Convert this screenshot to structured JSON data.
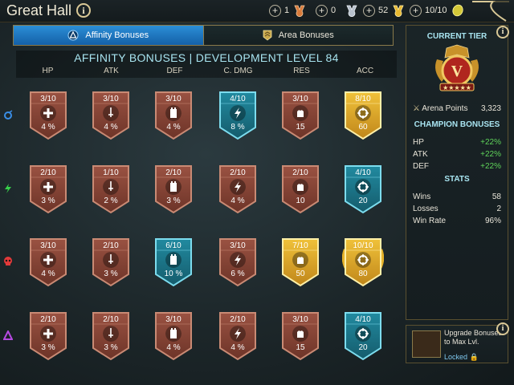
{
  "header": {
    "title": "Great Hall",
    "resources": [
      {
        "value": "1",
        "gem": "bronze-medal-icon",
        "color": "#d97a3a"
      },
      {
        "value": "0",
        "gem": "silver-medal-icon",
        "color": "#b7c0cc"
      },
      {
        "value": "52",
        "gem": "gold-medal-icon",
        "color": "#e8b830"
      },
      {
        "value": "10/10",
        "gem": "arena-token-icon",
        "color": "#d4c838"
      }
    ]
  },
  "tabs": [
    {
      "label": "Affinity Bonuses",
      "active": true
    },
    {
      "label": "Area Bonuses",
      "active": false
    }
  ],
  "section_title": "AFFINITY BONUSES | DEVELOPMENT LEVEL 84",
  "columns": [
    "HP",
    "ATK",
    "DEF",
    "C. DMG",
    "RES",
    "ACC"
  ],
  "rows": [
    {
      "affinity": "magic-affinity-icon",
      "color": "#3a8ee6",
      "cells": [
        {
          "level": "3/10",
          "value": "4 %",
          "tier": "bronze",
          "icon": "hp-icon"
        },
        {
          "level": "3/10",
          "value": "4 %",
          "tier": "bronze",
          "icon": "atk-icon"
        },
        {
          "level": "3/10",
          "value": "4 %",
          "tier": "bronze",
          "icon": "def-icon"
        },
        {
          "level": "4/10",
          "value": "8 %",
          "tier": "blue",
          "icon": "cdmg-icon"
        },
        {
          "level": "3/10",
          "value": "15",
          "tier": "bronze",
          "icon": "res-icon"
        },
        {
          "level": "8/10",
          "value": "60",
          "tier": "gold",
          "icon": "acc-icon"
        }
      ]
    },
    {
      "affinity": "force-affinity-icon",
      "color": "#37d24a",
      "cells": [
        {
          "level": "2/10",
          "value": "3 %",
          "tier": "bronze",
          "icon": "hp-icon"
        },
        {
          "level": "1/10",
          "value": "2 %",
          "tier": "bronze",
          "icon": "atk-icon"
        },
        {
          "level": "2/10",
          "value": "3 %",
          "tier": "bronze",
          "icon": "def-icon"
        },
        {
          "level": "2/10",
          "value": "4 %",
          "tier": "bronze",
          "icon": "cdmg-icon"
        },
        {
          "level": "2/10",
          "value": "10",
          "tier": "bronze",
          "icon": "res-icon"
        },
        {
          "level": "4/10",
          "value": "20",
          "tier": "blue",
          "icon": "acc-icon"
        }
      ]
    },
    {
      "affinity": "spirit-affinity-icon",
      "color": "#e23a3a",
      "cells": [
        {
          "level": "3/10",
          "value": "4 %",
          "tier": "bronze",
          "icon": "hp-icon"
        },
        {
          "level": "2/10",
          "value": "3 %",
          "tier": "bronze",
          "icon": "atk-icon"
        },
        {
          "level": "6/10",
          "value": "10 %",
          "tier": "blue",
          "icon": "def-icon"
        },
        {
          "level": "3/10",
          "value": "6 %",
          "tier": "bronze",
          "icon": "cdmg-icon"
        },
        {
          "level": "7/10",
          "value": "50",
          "tier": "gold",
          "icon": "res-icon"
        },
        {
          "level": "10/10",
          "value": "80",
          "tier": "gold-max",
          "icon": "acc-icon"
        }
      ]
    },
    {
      "affinity": "void-affinity-icon",
      "color": "#b44ae0",
      "cells": [
        {
          "level": "2/10",
          "value": "3 %",
          "tier": "bronze",
          "icon": "hp-icon"
        },
        {
          "level": "2/10",
          "value": "3 %",
          "tier": "bronze",
          "icon": "atk-icon"
        },
        {
          "level": "3/10",
          "value": "4 %",
          "tier": "bronze",
          "icon": "def-icon"
        },
        {
          "level": "2/10",
          "value": "4 %",
          "tier": "bronze",
          "icon": "cdmg-icon"
        },
        {
          "level": "3/10",
          "value": "15",
          "tier": "bronze",
          "icon": "res-icon"
        },
        {
          "level": "4/10",
          "value": "20",
          "tier": "blue",
          "icon": "acc-icon"
        }
      ]
    }
  ],
  "side": {
    "current_tier_label": "CURRENT TIER",
    "tier_numeral": "V",
    "arena_points_label": "Arena Points",
    "arena_points": "3,323",
    "champion_bonuses_label": "CHAMPION BONUSES",
    "bonuses": [
      {
        "label": "HP",
        "value": "+22%"
      },
      {
        "label": "ATK",
        "value": "+22%"
      },
      {
        "label": "DEF",
        "value": "+22%"
      }
    ],
    "stats_label": "STATS",
    "stats": [
      {
        "label": "Wins",
        "value": "58"
      },
      {
        "label": "Losses",
        "value": "2"
      },
      {
        "label": "Win Rate",
        "value": "96%"
      }
    ]
  },
  "upgrade": {
    "text": "Upgrade Bonuses to Max Lvl.",
    "status": "Locked"
  },
  "tier_colors": {
    "bronze": "#8a4a3c",
    "blue": "#1f7f92",
    "gold": "#e5b22a"
  }
}
